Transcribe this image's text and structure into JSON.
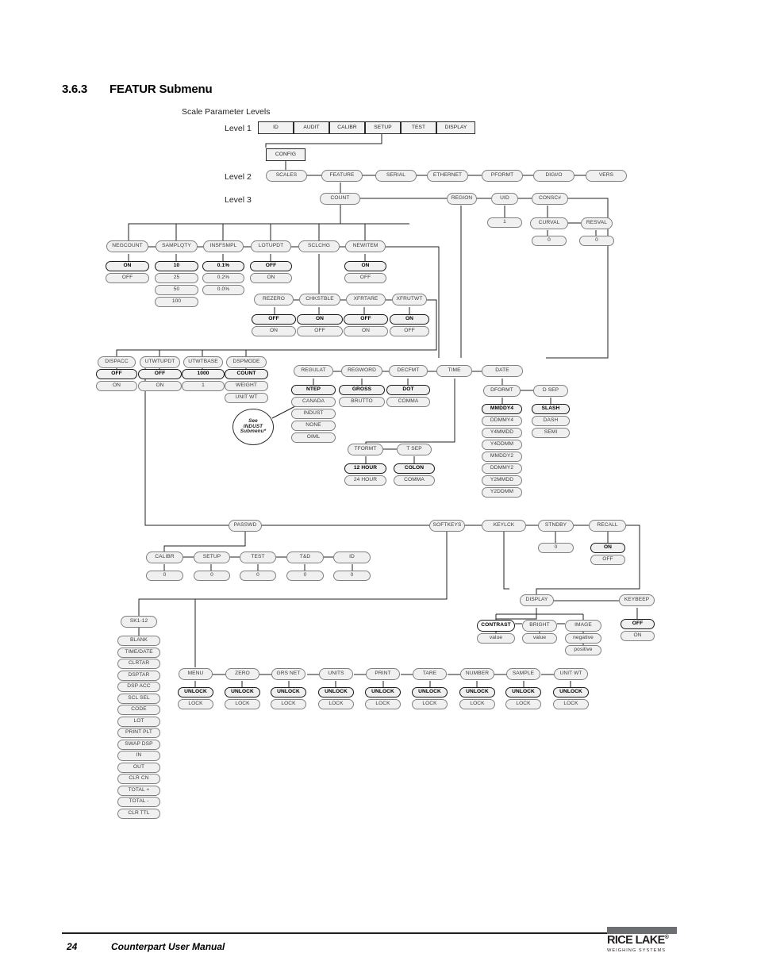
{
  "heading": {
    "number": "3.6.3",
    "title": "FEATUR Submenu"
  },
  "diagram": {
    "caption": "Scale Parameter Levels",
    "level_labels": [
      "Level 1",
      "Level 2",
      "Level 3"
    ],
    "level1": [
      "ID",
      "AUDIT",
      "CALIBR",
      "SETUP",
      "TEST",
      "DISPLAY"
    ],
    "config": "CONFIG",
    "level2": [
      "SCALES",
      "FEATURE",
      "SERIAL",
      "ETHERNET",
      "PFORMT",
      "DIGI/O",
      "VERS"
    ],
    "level3": [
      "COUNT",
      "REGION",
      "UID",
      "CONSC#"
    ],
    "uid_value": "1",
    "consc": {
      "curval": "CURVAL",
      "curval_value": "0",
      "resval": "RESVAL",
      "resval_value": "0"
    },
    "count_row1": [
      {
        "name": "NEGCOUNT",
        "options": [
          "ON",
          "OFF"
        ]
      },
      {
        "name": "SAMPLQTY",
        "options": [
          "10",
          "25",
          "50",
          "100"
        ]
      },
      {
        "name": "INSFSMPL",
        "options": [
          "0.1%",
          "0.2%",
          "0.0%"
        ]
      },
      {
        "name": "LOTUPDT",
        "options": [
          "OFF",
          "ON"
        ]
      },
      {
        "name": "SCLCHG",
        "options": []
      },
      {
        "name": "NEWITEM",
        "options": [
          "ON",
          "OFF"
        ]
      }
    ],
    "count_row2": [
      {
        "name": "REZERO",
        "options": [
          "OFF",
          "ON"
        ]
      },
      {
        "name": "CHKSTBLE",
        "options": [
          "ON",
          "OFF"
        ]
      },
      {
        "name": "XFRTARE",
        "options": [
          "OFF",
          "ON"
        ]
      },
      {
        "name": "XFRUTWT",
        "options": [
          "ON",
          "OFF"
        ]
      }
    ],
    "count_row3": [
      {
        "name": "DISPACC",
        "options": [
          "OFF",
          "ON"
        ]
      },
      {
        "name": "UTWTUPDT",
        "options": [
          "OFF",
          "ON"
        ]
      },
      {
        "name": "UTWTBASE",
        "options": [
          "1000",
          "1"
        ]
      },
      {
        "name": "DSPMODE",
        "options": [
          "COUNT",
          "WEIGHT",
          "UNIT WT"
        ]
      }
    ],
    "indust_note": [
      "See",
      "INDUST",
      "Submenu*"
    ],
    "region_row": [
      {
        "name": "REGULAT",
        "options": [
          "NTEP",
          "CANADA",
          "INDUST",
          "NONE",
          "OIML"
        ]
      },
      {
        "name": "REGWORD",
        "options": [
          "GROSS",
          "BRUTTO"
        ]
      },
      {
        "name": "DECFMT",
        "options": [
          "DOT",
          "COMMA"
        ]
      },
      {
        "name": "TIME",
        "options": []
      },
      {
        "name": "DATE",
        "options": []
      }
    ],
    "time_row": [
      {
        "name": "TFORMT",
        "options": [
          "12 HOUR",
          "24 HOUR"
        ]
      },
      {
        "name": "T SEP",
        "options": [
          "COLON",
          "COMMA"
        ]
      }
    ],
    "date_row": [
      {
        "name": "DFORMT",
        "options": [
          "MMDDY4",
          "DDMMY4",
          "Y4MMDD",
          "Y4DDMM",
          "MMDDY2",
          "DDMMY2",
          "Y2MMDD",
          "Y2DDMM"
        ]
      },
      {
        "name": "D SEP",
        "options": [
          "SLASH",
          "DASH",
          "SEMI"
        ]
      }
    ],
    "passwd": "PASSWD",
    "passwd_row": [
      {
        "name": "CALIBR",
        "options": [
          "0"
        ]
      },
      {
        "name": "SETUP",
        "options": [
          "0"
        ]
      },
      {
        "name": "TEST",
        "options": [
          "0"
        ]
      },
      {
        "name": "T&D",
        "options": [
          "0"
        ]
      },
      {
        "name": "ID",
        "options": [
          "0"
        ]
      }
    ],
    "softkeys": "SOFTKEYS",
    "keylck": "KEYLCK",
    "stndby": {
      "name": "STNDBY",
      "options": [
        "0"
      ]
    },
    "recall": {
      "name": "RECALL",
      "options": [
        "ON",
        "OFF"
      ]
    },
    "display": {
      "name": "DISPLAY"
    },
    "keybeep": {
      "name": "KEYBEEP",
      "options": [
        "OFF",
        "ON"
      ]
    },
    "display_row": [
      {
        "name": "CONTRAST",
        "options": [
          "value"
        ]
      },
      {
        "name": "BRIGHT",
        "options": [
          "value"
        ]
      },
      {
        "name": "IMAGE",
        "options": [
          "negative",
          "positive"
        ]
      }
    ],
    "sk_head": "SK1-12",
    "sk_list": [
      "BLANK",
      "TIME/DATE",
      "CLRTAR",
      "DSPTAR",
      "DSP ACC",
      "SCL SEL",
      "CODE",
      "LOT",
      "PRINT PLT",
      "SWAP DSP",
      "IN",
      "OUT",
      "CLR CN",
      "TOTAL +",
      "TOTAL -",
      "CLR TTL"
    ],
    "lock_row": [
      {
        "name": "MENU",
        "options": [
          "UNLOCK",
          "LOCK"
        ]
      },
      {
        "name": "ZERO",
        "options": [
          "UNLOCK",
          "LOCK"
        ]
      },
      {
        "name": "GRS NET",
        "options": [
          "UNLOCK",
          "LOCK"
        ]
      },
      {
        "name": "UNITS",
        "options": [
          "UNLOCK",
          "LOCK"
        ]
      },
      {
        "name": "PRINT",
        "options": [
          "UNLOCK",
          "LOCK"
        ]
      },
      {
        "name": "TARE",
        "options": [
          "UNLOCK",
          "LOCK"
        ]
      },
      {
        "name": "NUMBER",
        "options": [
          "UNLOCK",
          "LOCK"
        ]
      },
      {
        "name": "SAMPLE",
        "options": [
          "UNLOCK",
          "LOCK"
        ]
      },
      {
        "name": "UNIT WT",
        "options": [
          "UNLOCK",
          "LOCK"
        ]
      }
    ]
  },
  "footer": {
    "page_number": "24",
    "manual_title": "Counterpart User Manual",
    "logo_name": "RICE LAKE",
    "logo_reg": "®",
    "logo_tagline": "WEIGHING SYSTEMS"
  }
}
